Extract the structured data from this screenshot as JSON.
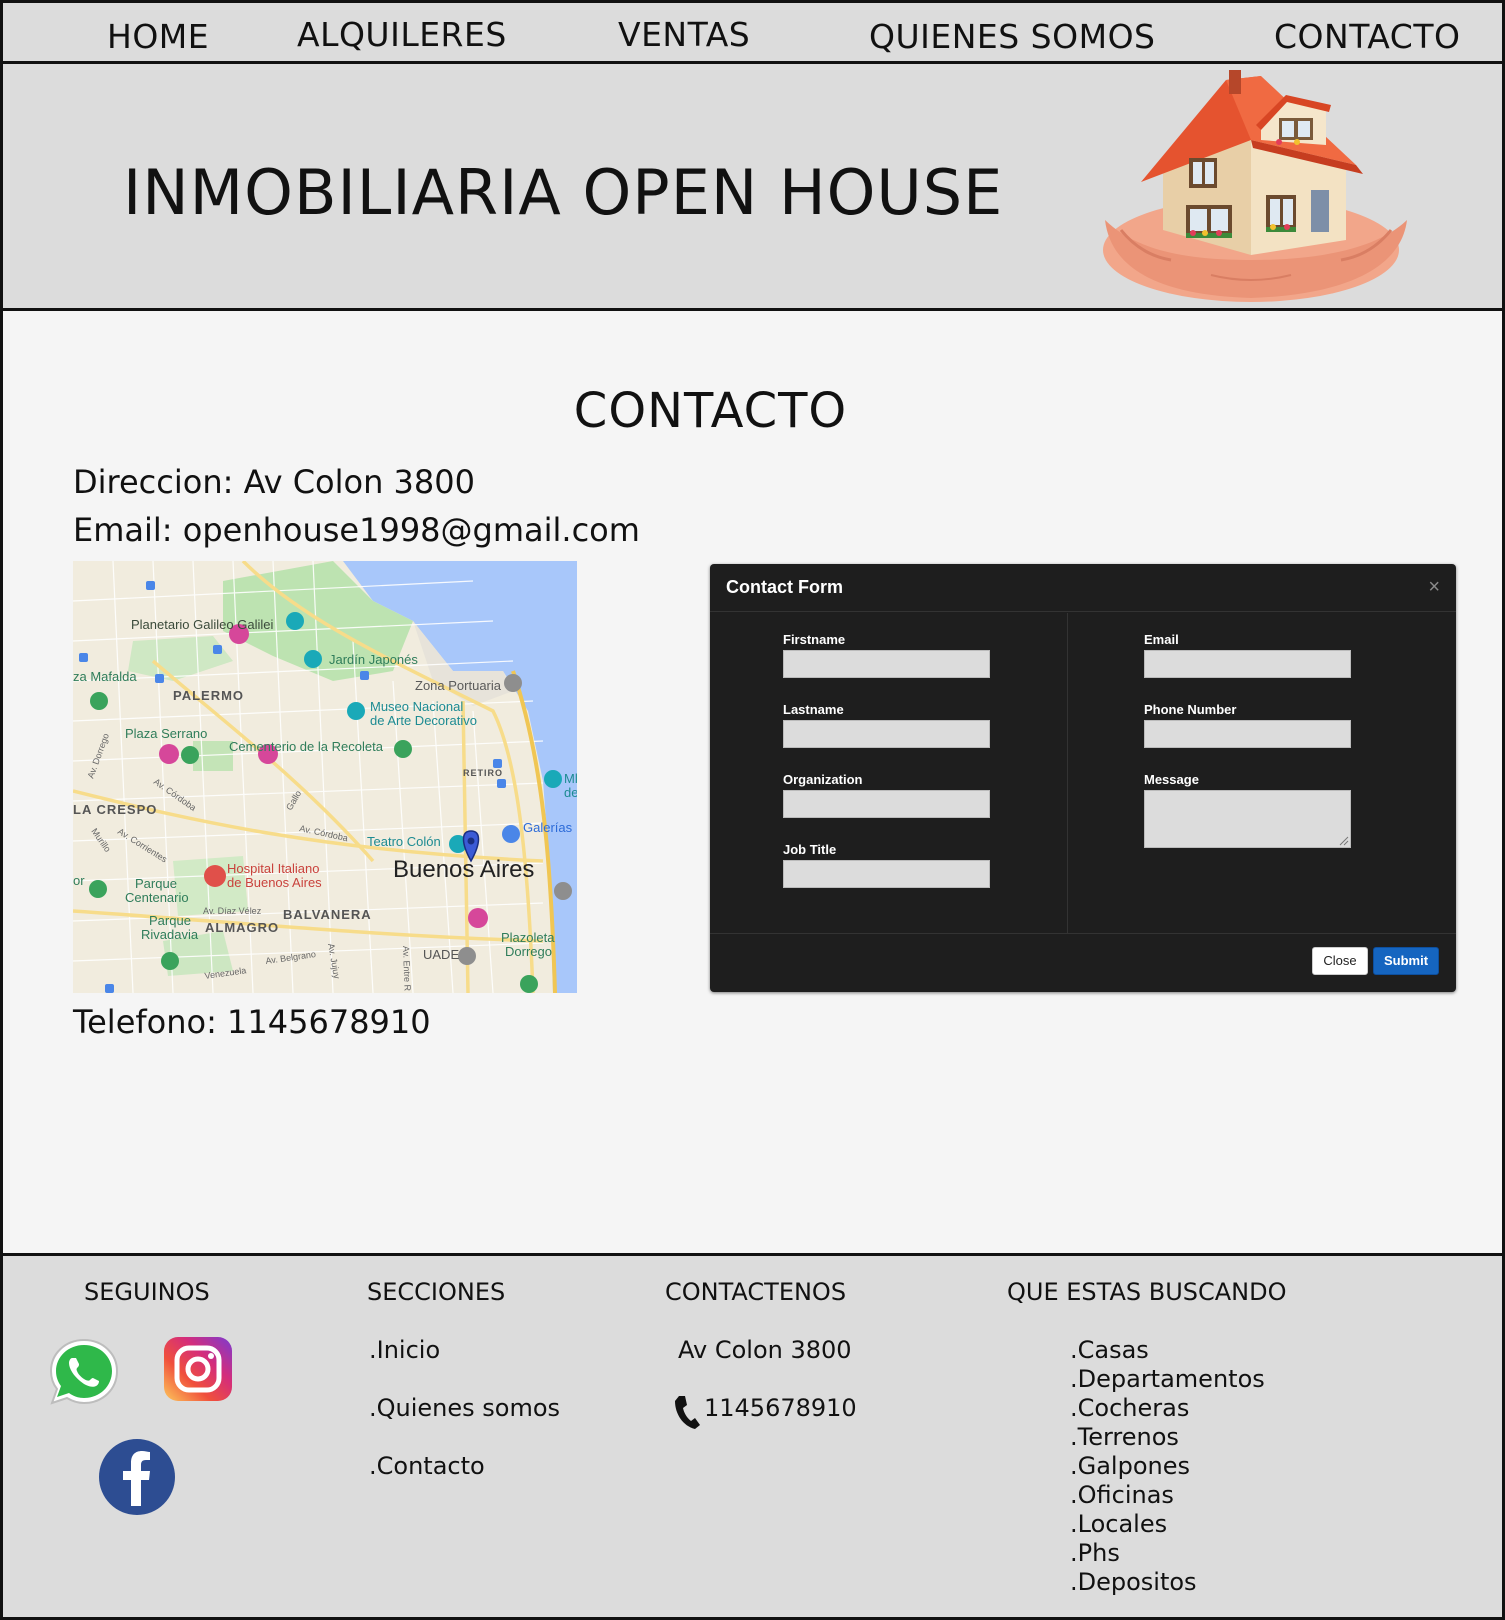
{
  "nav": {
    "items": [
      {
        "label": "HOME"
      },
      {
        "label": "ALQUILERES"
      },
      {
        "label": "VENTAS"
      },
      {
        "label": "QUIENES SOMOS"
      },
      {
        "label": "CONTACTO"
      }
    ]
  },
  "header": {
    "title": "INMOBILIARIA OPEN HOUSE",
    "logo_icon": "house-in-hands-icon"
  },
  "main": {
    "heading": "CONTACTO",
    "address": "Direccion: Av Colon 3800",
    "email": "Email: openhouse1998@gmail.com",
    "phone": "Telefono: 1145678910"
  },
  "map": {
    "city_label": "Buenos Aires",
    "places": [
      "Planetario Galileo Galilei",
      "Jardín Japonés",
      "Zona Portuaria",
      "Museo Nacional",
      "de Arte Decorativo",
      "PALERMO",
      "Plaza Serrano",
      "Cementerio de la Recoleta",
      "RETIRO",
      "LA CRESPO",
      "Teatro Colón",
      "Galerías",
      "Hospital Italiano",
      "de Buenos Aires",
      "Parque",
      "Centenario",
      "BALVANERA",
      "Parque",
      "Rivadavia",
      "ALMAGRO",
      "UADE",
      "Plazoleta",
      "Dorrego",
      "za Mafalda",
      "Av. Córdoba",
      "Av. Díaz Vélez",
      "Av. Belgrano",
      "Venezuela",
      "Av. Corrientes",
      "Av. Entre R",
      "Ml",
      "de",
      "Av. Dorrego",
      "Murillo",
      "Gallo",
      "Av. Córdoba",
      "Av. Jujuy",
      "or"
    ],
    "colors": {
      "water": "#a8c7fa",
      "land": "#f1ecde",
      "park": "#bde3b1",
      "road": "#f7dc8a"
    }
  },
  "modal": {
    "title": "Contact Form",
    "close_x": "×",
    "fields_left": [
      {
        "label": "Firstname",
        "value": ""
      },
      {
        "label": "Lastname",
        "value": ""
      },
      {
        "label": "Organization",
        "value": ""
      },
      {
        "label": "Job Title",
        "value": ""
      }
    ],
    "fields_right": [
      {
        "label": "Email",
        "value": ""
      },
      {
        "label": "Phone Number",
        "value": ""
      },
      {
        "label": "Message",
        "value": ""
      }
    ],
    "close_label": "Close",
    "submit_label": "Submit",
    "colors": {
      "background": "#1e1e1e",
      "submit": "#1565c0"
    }
  },
  "footer": {
    "seguinos": {
      "title": "SEGUINOS",
      "icons": [
        "whatsapp-icon",
        "instagram-icon",
        "facebook-icon"
      ]
    },
    "secciones": {
      "title": "SECCIONES",
      "links": [
        ".Inicio",
        ".Quienes somos",
        ".Contacto"
      ]
    },
    "contactenos": {
      "title": "CONTACTENOS",
      "address": "Av Colon 3800",
      "phone": "1145678910",
      "phone_icon": "phone-icon"
    },
    "buscando": {
      "title": "QUE ESTAS BUSCANDO",
      "items": [
        ".Casas",
        ".Departamentos",
        ".Cocheras",
        ".Terrenos",
        ".Galpones",
        ".Oficinas",
        ".Locales",
        ".Phs",
        ".Depositos"
      ]
    }
  }
}
